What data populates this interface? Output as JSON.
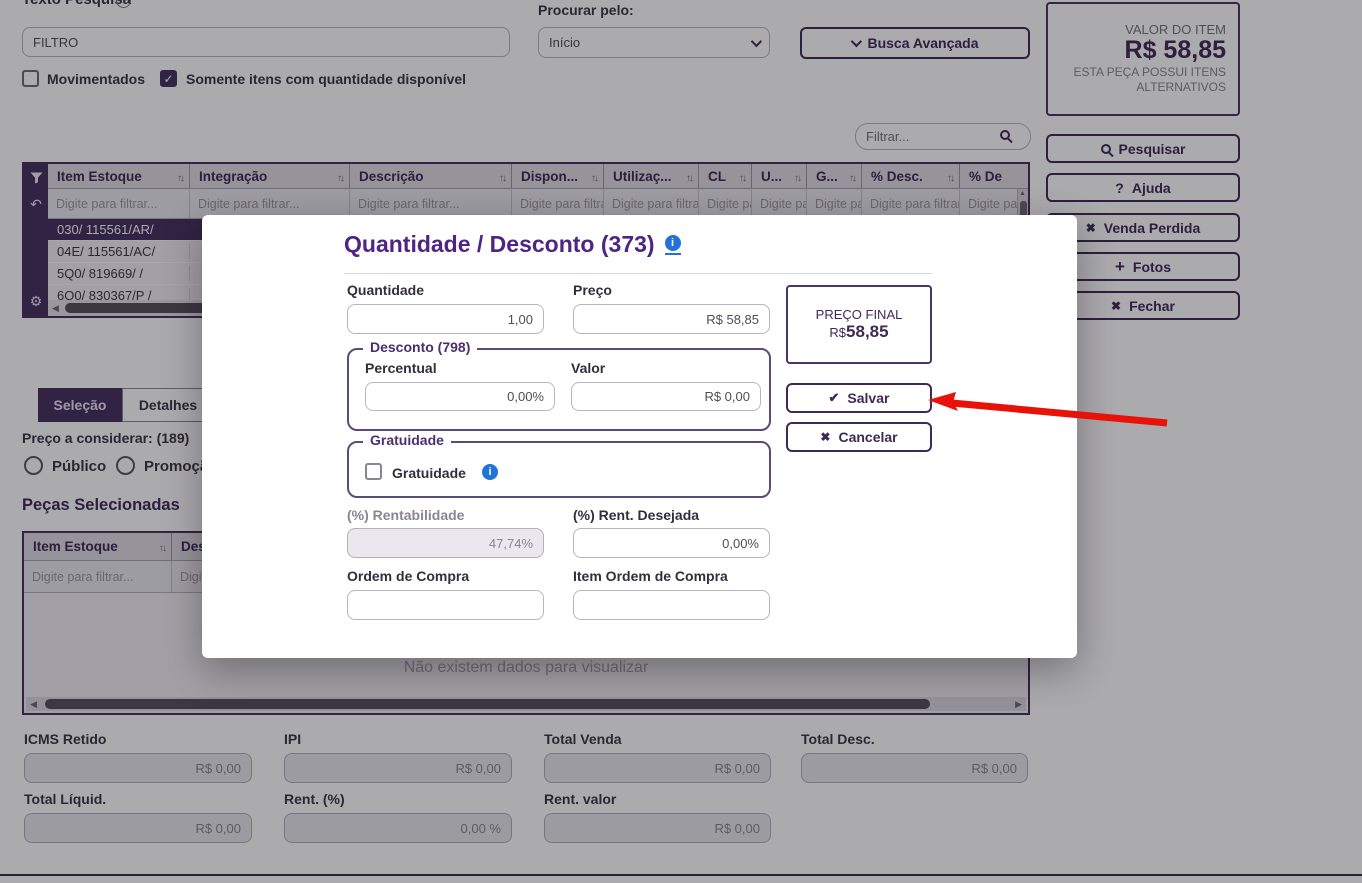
{
  "header": {
    "texto_pesquisa_label": "Texto Pesquisa",
    "texto_pesquisa_value": "FILTRO",
    "movimentados_label": "Movimentados",
    "somente_itens_label": "Somente itens com quantidade disponível",
    "procurar_pelo_label": "Procurar pelo:",
    "procurar_pelo_value": "Início",
    "busca_avancada_label": "Busca Avançada"
  },
  "item_panel": {
    "valor_label": "VALOR DO ITEM",
    "valor_value": "R$ 58,85",
    "alternativos_note": "ESTA PEÇA POSSUI ITENS ALTERNATIVOS",
    "pesquisar_label": "Pesquisar",
    "ajuda_label": "Ajuda",
    "venda_perdida_label": "Venda Perdida",
    "fotos_label": "Fotos",
    "fechar_label": "Fechar"
  },
  "filter_input": {
    "placeholder": "Filtrar..."
  },
  "results_table": {
    "columns": [
      "Item Estoque",
      "Integração",
      "Descrição",
      "Dispon...",
      "Utilizaç...",
      "CL",
      "U...",
      "G...",
      "% Desc.",
      "% De"
    ],
    "filter_placeholder": "Digite para filtrar...",
    "rows": [
      "030/ 115561/AR/",
      "04E/ 115561/AC/",
      "5Q0/ 819669/ /",
      "6Q0/ 830367/P /"
    ],
    "selected_row": "030/ 115561/AR/"
  },
  "tabs": {
    "selecao": "Seleção",
    "detalhes": "Detalhes"
  },
  "price_options": {
    "label": "Preço a considerar: (189)",
    "publico_label": "Público",
    "promocao_label": "Promoção"
  },
  "selected_parts": {
    "title": "Peças Selecionadas",
    "columns": [
      "Item Estoque",
      "Descrição"
    ],
    "filter_placeholder": "Digite para filtrar...",
    "empty_message": "Não existem dados para visualizar"
  },
  "totals": {
    "fields": [
      {
        "label": "ICMS Retido",
        "value": "R$ 0,00"
      },
      {
        "label": "IPI",
        "value": "R$ 0,00"
      },
      {
        "label": "Total Venda",
        "value": "R$ 0,00"
      },
      {
        "label": "Total Desc.",
        "value": "R$ 0,00"
      },
      {
        "label": "Total Líquid.",
        "value": "R$ 0,00"
      },
      {
        "label": "Rent. (%)",
        "value": "0,00 %"
      },
      {
        "label": "Rent. valor",
        "value": "R$ 0,00"
      }
    ]
  },
  "modal": {
    "title": "Quantidade / Desconto (373)",
    "quantidade_label": "Quantidade",
    "quantidade_value": "1,00",
    "preco_label": "Preço",
    "preco_value": "R$ 58,85",
    "preco_final_label": "PREÇO FINAL",
    "preco_final_currency": "R$",
    "preco_final_amount": "58,85",
    "desconto_legend": "Desconto (798)",
    "percentual_label": "Percentual",
    "percentual_value": "0,00%",
    "valor_label": "Valor",
    "valor_value": "R$ 0,00",
    "gratuidade_legend": "Gratuidade",
    "gratuidade_checkbox_label": "Gratuidade",
    "rentabilidade_label": "(%) Rentabilidade",
    "rentabilidade_value": "47,74%",
    "rent_desejada_label": "(%) Rent. Desejada",
    "rent_desejada_value": "0,00%",
    "ordem_compra_label": "Ordem de Compra",
    "item_ordem_compra_label": "Item Ordem de Compra",
    "salvar_label": "Salvar",
    "cancelar_label": "Cancelar"
  },
  "colors": {
    "accent_purple": "#44305e",
    "title_purple": "#4f2583",
    "info_blue": "#2172d9",
    "arrow_red": "#e91208"
  }
}
